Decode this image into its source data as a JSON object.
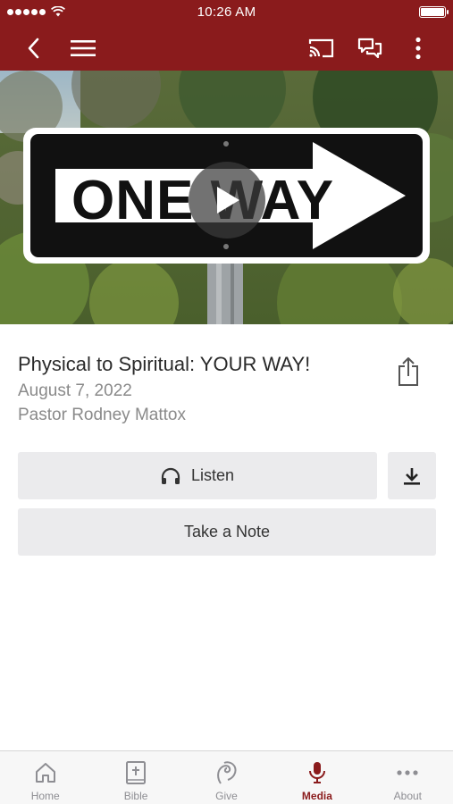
{
  "status_bar": {
    "time": "10:26 AM"
  },
  "app_bar": {
    "icons": [
      "back-icon",
      "menu-icon",
      "cast-icon",
      "chat-icon",
      "more-vertical-icon"
    ]
  },
  "hero": {
    "sign_text": "ONE WAY",
    "play_icon": "play-icon"
  },
  "sermon": {
    "title": "Physical to Spiritual: YOUR WAY!",
    "date": "August 7, 2022",
    "speaker": "Pastor Rodney Mattox"
  },
  "actions": {
    "listen_label": "Listen",
    "take_note_label": "Take a Note"
  },
  "tabs": [
    {
      "label": "Home",
      "icon": "home-icon"
    },
    {
      "label": "Bible",
      "icon": "bible-icon"
    },
    {
      "label": "Give",
      "icon": "give-icon"
    },
    {
      "label": "Media",
      "icon": "microphone-icon",
      "active": true
    },
    {
      "label": "About",
      "icon": "more-horizontal-icon"
    }
  ],
  "colors": {
    "brand": "#8a1b1c",
    "button_bg": "#ebebed",
    "tab_inactive": "#8e8e93"
  }
}
